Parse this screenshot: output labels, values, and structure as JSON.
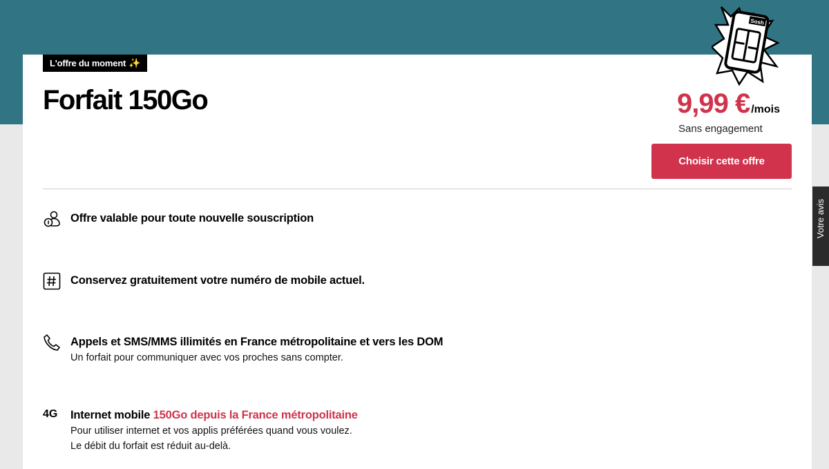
{
  "badge": {
    "label": "L'offre du moment",
    "icon": "sparkle-emoji"
  },
  "offer": {
    "title": "Forfait 150Go",
    "price": "9,99 €",
    "per": "/mois",
    "commitment": "Sans engagement",
    "cta": "Choisir cette offre",
    "sim_brand": "Sosh"
  },
  "features": [
    {
      "icon": "users-icon",
      "title": "Offre valable pour toute nouvelle souscription"
    },
    {
      "icon": "hash-icon",
      "title": "Conservez gratuitement votre numéro de mobile actuel."
    },
    {
      "icon": "phone-icon",
      "title": "Appels et SMS/MMS illimités en France métropolitaine et vers les DOM",
      "sub": "Un forfait pour communiquer avec vos proches sans compter."
    },
    {
      "icon_text": "4G",
      "title_plain": "Internet mobile ",
      "title_accent": "150Go depuis la France métropolitaine",
      "sub1": "Pour utiliser internet et vos applis préférées quand vous voulez.",
      "sub2": "Le débit du forfait est réduit au-delà."
    }
  ],
  "side_tab": {
    "label": "Votre avis"
  },
  "colors": {
    "band": "#317584",
    "accent": "#d0334b",
    "black": "#000000"
  }
}
